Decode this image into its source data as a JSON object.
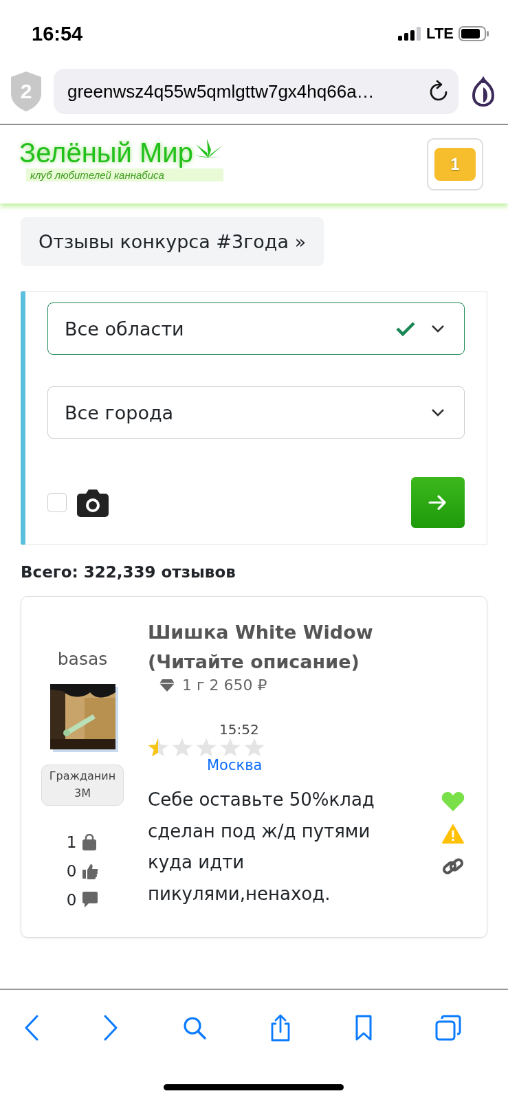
{
  "status_bar": {
    "time": "16:54",
    "network": "LTE"
  },
  "browser": {
    "tracker_count": "2",
    "url": "greenwsz4q55w5qmlgttw7gx4hq66a…"
  },
  "header": {
    "logo_title": "Зелёный Мир",
    "logo_subtitle": "клуб любителей каннабиса",
    "cart_count": "1"
  },
  "breadcrumb": "Отзывы конкурса #3года »",
  "filters": {
    "region": {
      "value": "Все области",
      "valid": true
    },
    "city": {
      "value": "Все города",
      "valid": false
    },
    "photo_only": {
      "checked": false
    }
  },
  "total": "Всего: 322,339 отзывов",
  "reviews": [
    {
      "author": "basas",
      "rank": "Гражданин 3M",
      "title": "Шишка White Widow (Читайте описание)",
      "price": "1 г 2 650 ₽",
      "time": "15:52",
      "stars": 0.5,
      "city": "Москва",
      "text": "Себе оставьте 50%клад сделан под ж/д путями куда идти пикулями,ненаход.",
      "purchases": "1",
      "likes": "0",
      "comments": "0",
      "liked": true
    }
  ]
}
